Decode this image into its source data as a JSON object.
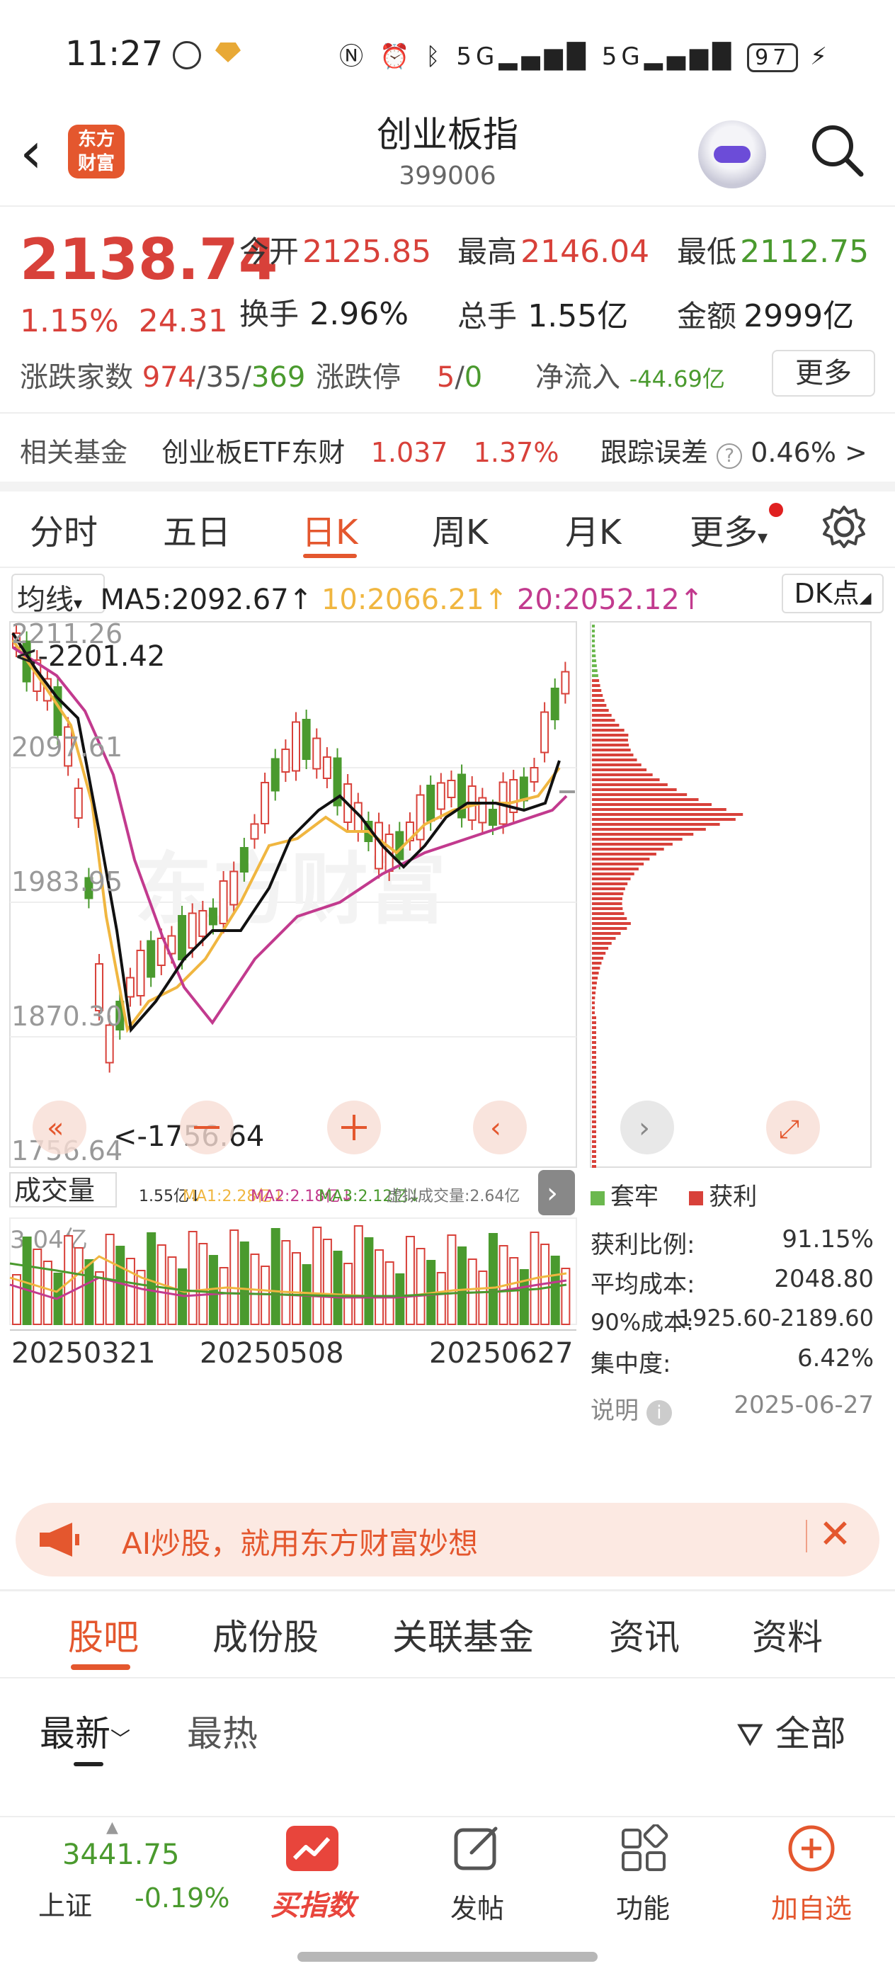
{
  "status_bar": {
    "time": "11:27",
    "battery": "97",
    "network": "5G"
  },
  "header": {
    "title": "创业板指",
    "code": "399006",
    "logo_line1": "东方",
    "logo_line2": "财富"
  },
  "quote": {
    "price": "2138.74",
    "change_pct": "1.15%",
    "change_abs": "24.31",
    "open_label": "今开",
    "open": "2125.85",
    "high_label": "最高",
    "high": "2146.04",
    "low_label": "最低",
    "low": "2112.75",
    "turnover_label": "换手",
    "turnover": "2.96%",
    "volume_label": "总手",
    "volume": "1.55亿",
    "amount_label": "金额",
    "amount": "2999亿",
    "breadth_label": "涨跌家数",
    "breadth_up": "974",
    "breadth_flat": "35",
    "breadth_down": "369",
    "limit_label": "涨跌停",
    "limit_up": "5",
    "limit_down": "0",
    "netflow_label": "净流入",
    "netflow": "-44.69亿",
    "more_button": "更多"
  },
  "related_fund": {
    "label": "相关基金",
    "name": "创业板ETF东财",
    "price": "1.037",
    "pct": "1.37%",
    "tracking_label": "跟踪误差",
    "tracking": "0.46%",
    "arrow": ">"
  },
  "chart_tabs": [
    "分时",
    "五日",
    "日K",
    "周K",
    "月K",
    "更多"
  ],
  "chart_tab_active": "日K",
  "ma_bar": {
    "selector": "均线",
    "ma5": "MA5:2092.67",
    "ma10": "10:2066.21",
    "ma20": "20:2052.12",
    "dk_button": "DK点"
  },
  "kline": {
    "y_ticks": [
      "2211.26",
      "2097.61",
      "1983.95",
      "1870.30",
      "1756.64"
    ],
    "max_marker": "<-2201.42",
    "min_marker": "<-1756.64",
    "x_labels": [
      "20250321",
      "20250508",
      "20250627"
    ]
  },
  "volume_panel": {
    "selector": "成交量",
    "summary": "1.55亿↓",
    "ma1": "MA1:2.28亿↓",
    "ma2": "MA2:2.18亿↓",
    "ma3": "MA3:2.12亿↓",
    "virtual": "虚拟成交量:2.64亿",
    "top_label": "3.04亿"
  },
  "chip": {
    "legend_loss": "套牢",
    "legend_profit": "获利",
    "profit_ratio_label": "获利比例:",
    "profit_ratio": "91.15%",
    "avg_cost_label": "平均成本:",
    "avg_cost": "2048.80",
    "cost90_label": "90%成本:",
    "cost90": "1925.60-2189.60",
    "concentration_label": "集中度:",
    "concentration": "6.42%",
    "note_label": "说明",
    "date": "2025-06-27"
  },
  "ad": {
    "text": "AI炒股，就用东方财富妙想"
  },
  "bottom_tabs": [
    "股吧",
    "成份股",
    "关联基金",
    "资讯",
    "资料"
  ],
  "bottom_tab_active": "股吧",
  "feed_sort": {
    "latest": "最新",
    "hot": "最热",
    "filter": "全部"
  },
  "nav": {
    "index_value": "3441.75",
    "index_name": "上证",
    "index_pct": "-0.19%",
    "buy_index": "买指数",
    "post": "发帖",
    "functions": "功能",
    "add_watch": "加自选"
  },
  "colors": {
    "accent": "#e4572e",
    "up": "#d8413a",
    "down": "#4a9a2e",
    "ma10": "#f0b640",
    "ma20": "#c23a8e"
  }
}
